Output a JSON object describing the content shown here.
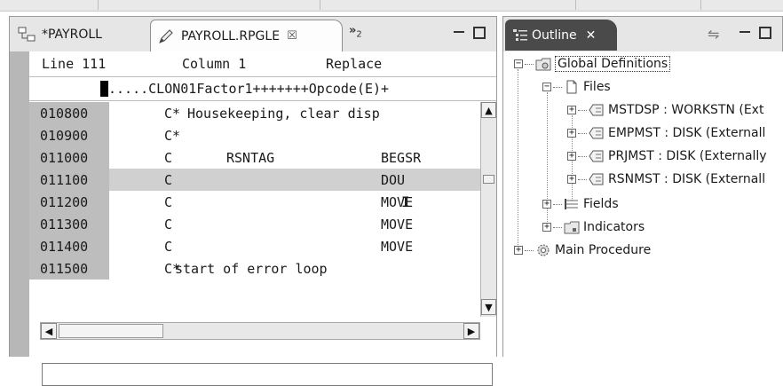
{
  "editor": {
    "tabs": [
      {
        "label": "*PAYROLL",
        "icon": "rse-project-icon"
      },
      {
        "label": "PAYROLL.RPGLE",
        "icon": "pencil-icon",
        "close": "☒"
      }
    ],
    "overflow": {
      "symbol": "»",
      "count": "2"
    },
    "status": {
      "line": "Line 111",
      "column": "Column 1",
      "mode": "Replace"
    },
    "ruler": ".....CLON01Factor1+++++++Opcode(E)+",
    "lines": [
      {
        "seq": "010800",
        "spec": "C*",
        "comment": "Housekeeping, clear disp",
        "factor1": "",
        "opcode": ""
      },
      {
        "seq": "010900",
        "spec": "C*",
        "comment": "",
        "factor1": "",
        "opcode": ""
      },
      {
        "seq": "011000",
        "spec": "C",
        "comment": "",
        "factor1": "RSNTAG",
        "opcode": "BEGSR"
      },
      {
        "seq": "011100",
        "spec": "C",
        "comment": "",
        "factor1": "",
        "opcode": "DOU"
      },
      {
        "seq": "011200",
        "spec": "C",
        "comment": "",
        "factor1": "",
        "opcode": "MOVE"
      },
      {
        "seq": "011300",
        "spec": "C",
        "comment": "",
        "factor1": "",
        "opcode": "MOVE"
      },
      {
        "seq": "011400",
        "spec": "C",
        "comment": "",
        "factor1": "",
        "opcode": "MOVE"
      },
      {
        "seq": "011500",
        "spec": "C*",
        "comment": "start of error loop",
        "factor1": "",
        "opcode": ""
      }
    ],
    "command_line": ""
  },
  "outline": {
    "tab_label": "Outline",
    "close": "✕",
    "tree": {
      "global": "Global Definitions",
      "files": "Files",
      "file_items": [
        "MSTDSP : WORKSTN (Ext",
        "EMPMST : DISK (Externall",
        "PRJMST : DISK (Externally",
        "RSNMST : DISK (Externall"
      ],
      "fields": "Fields",
      "indicators": "Indicators",
      "main": "Main Procedure"
    }
  }
}
